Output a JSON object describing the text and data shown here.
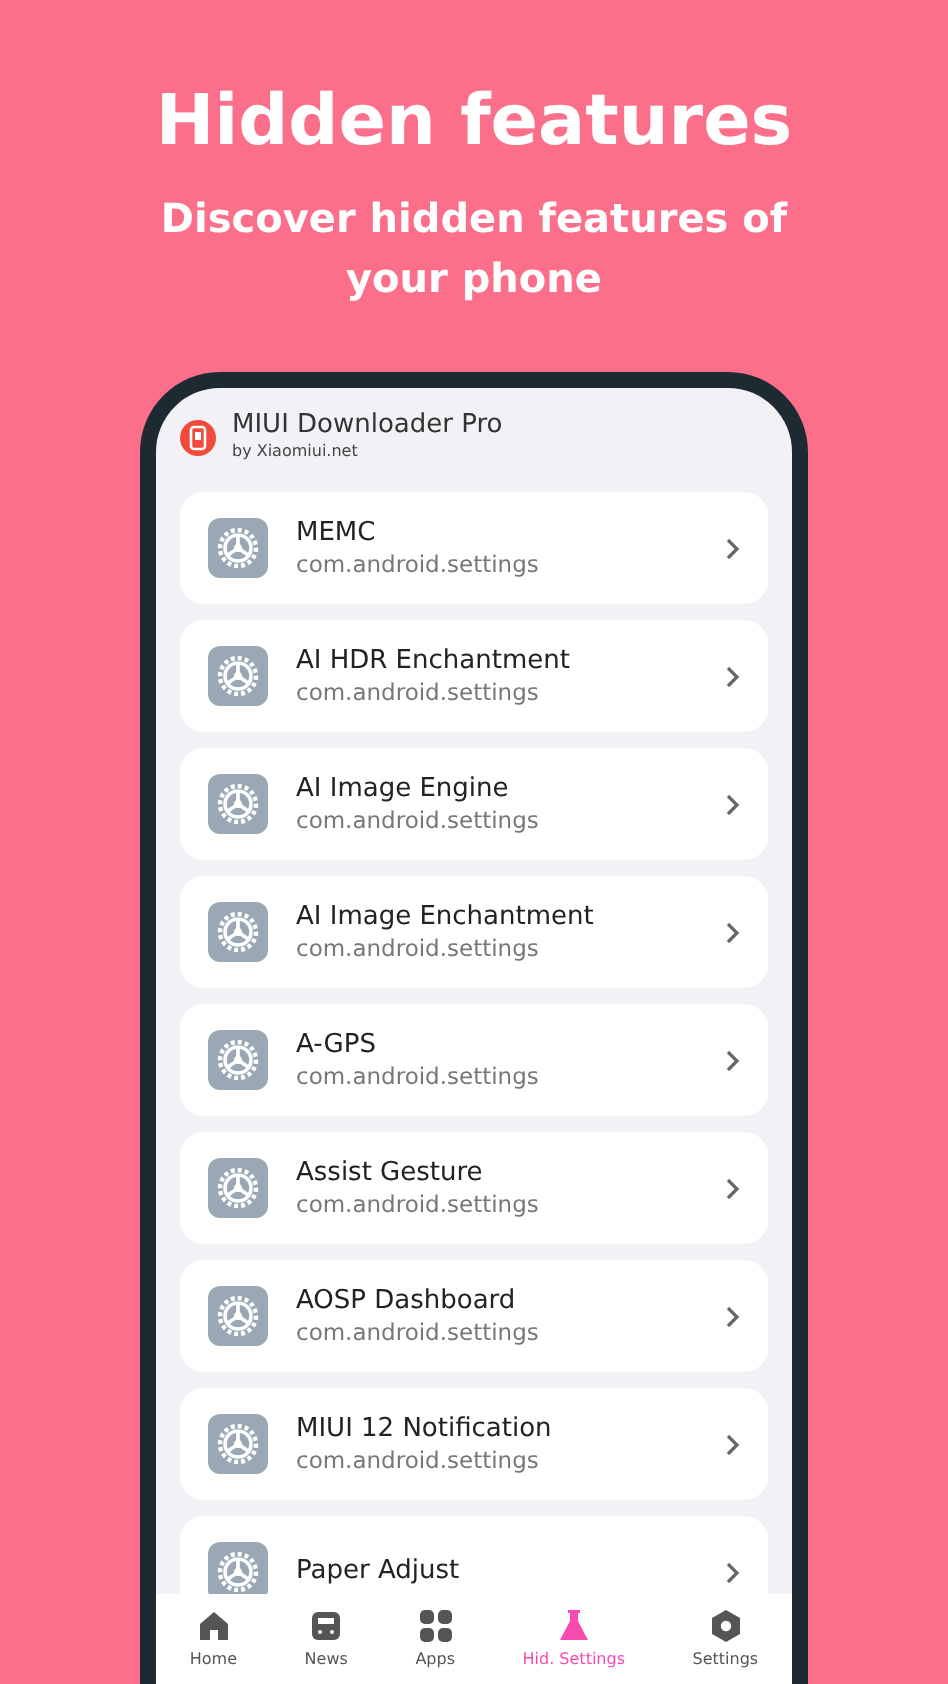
{
  "headline": "Hidden features",
  "subheadline": "Discover hidden features of your phone",
  "app": {
    "title": "MIUI Downloader Pro",
    "subtitle": "by Xiaomiui.net"
  },
  "items": [
    {
      "title": "MEMC",
      "package": "com.android.settings"
    },
    {
      "title": "AI HDR Enchantment",
      "package": "com.android.settings"
    },
    {
      "title": "AI Image Engine",
      "package": "com.android.settings"
    },
    {
      "title": "AI Image Enchantment",
      "package": "com.android.settings"
    },
    {
      "title": "A-GPS",
      "package": "com.android.settings"
    },
    {
      "title": "Assist Gesture",
      "package": "com.android.settings"
    },
    {
      "title": "AOSP Dashboard",
      "package": "com.android.settings"
    },
    {
      "title": "MIUI 12 Notification",
      "package": "com.android.settings"
    },
    {
      "title": "Paper Adjust"
    }
  ],
  "nav": [
    {
      "label": "Home",
      "kind": "home",
      "selected": false
    },
    {
      "label": "News",
      "kind": "news",
      "selected": false
    },
    {
      "label": "Apps",
      "kind": "apps",
      "selected": false
    },
    {
      "label": "Hid. Settings",
      "kind": "flask",
      "selected": true
    },
    {
      "label": "Settings",
      "kind": "hex",
      "selected": false
    }
  ]
}
